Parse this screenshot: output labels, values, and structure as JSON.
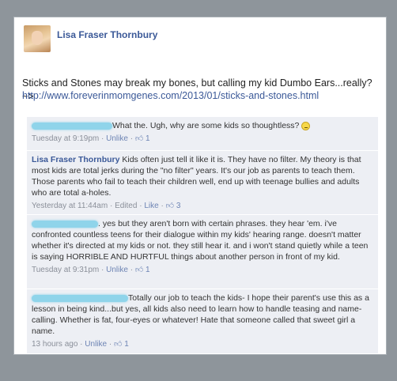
{
  "post": {
    "author": "Lisa Fraser Thornbury",
    "status_text": "Sticks and Stones may break my bones, but calling my kid Dumbo Ears...really? ~>",
    "link_text": "http://www.foreverinmomgenes.com/2013/01/sticks-and-stones.html"
  },
  "comments": [
    {
      "author": "",
      "text": "What the. Ugh, why are some kids so thoughtless?",
      "time": "Tuesday at 9:19pm",
      "unlike": "Unlike",
      "likes": "1",
      "edited": ""
    },
    {
      "author": "Lisa Fraser Thornbury",
      "text": "Kids often just tell it like it is. They have no filter. My theory is that most kids are total jerks during the \"no filter\" years. It's our job as parents to teach them. Those parents who fail to teach their children well, end up with teenage bullies and adults who are total a-holes.",
      "time": "Yesterday at 11:44am",
      "edited": "Edited",
      "like": "Like",
      "likes": "3"
    },
    {
      "author": "",
      "text": ". yes but they aren't born with certain phrases. they hear 'em. i've confronted countless teens for their dialogue within my kids' hearing range. doesn't matter whether it's directed at my kids or not. they still hear it. and i won't stand quietly while a teen is saying HORRIBLE AND HURTFUL things about another person in front of my kid.",
      "time": "Tuesday at 9:31pm",
      "unlike": "Unlike",
      "likes": "1"
    },
    {
      "author": "",
      "text": "Totally our job to teach the kids- I hope their parent's use this as a lesson in being kind...but yes, all kids also need to learn how to handle teasing and name-calling. Whether is fat, four-eyes or whatever! Hate that someone called that sweet girl a name.",
      "time": "13 hours ago",
      "unlike": "Unlike",
      "likes": "1"
    }
  ],
  "colors": {
    "background": "#8e959b",
    "link_blue": "#3b5998",
    "comment_bg": "#edeff4",
    "redaction": "#8fd4ea"
  },
  "icons": {
    "like": "thumbs-up-icon",
    "emoji": "frown-emoji-icon",
    "redaction": "redacted-name"
  }
}
